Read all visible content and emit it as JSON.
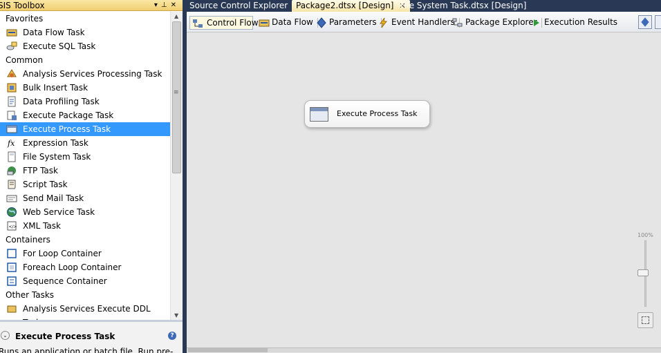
{
  "toolbox": {
    "title": "SIS Toolbox",
    "title_buttons": [
      "▾",
      "⊥",
      "✕"
    ],
    "groups": [
      {
        "label": "Favorites",
        "items": [
          {
            "label": "Data Flow Task",
            "icon": "data-flow-task-icon"
          },
          {
            "label": "Execute SQL Task",
            "icon": "execute-sql-task-icon"
          }
        ]
      },
      {
        "label": "Common",
        "items": [
          {
            "label": "Analysis Services Processing Task",
            "icon": "analysis-services-icon"
          },
          {
            "label": "Bulk Insert Task",
            "icon": "bulk-insert-icon"
          },
          {
            "label": "Data Profiling Task",
            "icon": "data-profiling-icon"
          },
          {
            "label": "Execute Package Task",
            "icon": "execute-package-icon"
          },
          {
            "label": "Execute Process Task",
            "icon": "execute-process-icon",
            "selected": true
          },
          {
            "label": "Expression Task",
            "icon": "expression-icon"
          },
          {
            "label": "File System Task",
            "icon": "file-system-icon"
          },
          {
            "label": "FTP Task",
            "icon": "ftp-icon"
          },
          {
            "label": "Script Task",
            "icon": "script-icon"
          },
          {
            "label": "Send Mail Task",
            "icon": "send-mail-icon"
          },
          {
            "label": "Web Service Task",
            "icon": "web-service-icon"
          },
          {
            "label": "XML Task",
            "icon": "xml-icon"
          }
        ]
      },
      {
        "label": "Containers",
        "items": [
          {
            "label": "For Loop Container",
            "icon": "for-loop-icon"
          },
          {
            "label": "Foreach Loop Container",
            "icon": "foreach-loop-icon"
          },
          {
            "label": "Sequence Container",
            "icon": "sequence-icon"
          }
        ]
      },
      {
        "label": "Other Tasks",
        "items": [
          {
            "label": "Analysis Services Execute DDL Task",
            "icon": "analysis-ddl-icon"
          }
        ]
      }
    ],
    "description": {
      "name": "Execute Process Task",
      "text": "Runs an application or batch file. Run pre-"
    }
  },
  "document_tabs": [
    {
      "label": "Source Control Explorer",
      "active": false
    },
    {
      "label": "Package2.dtsx [Design]",
      "active": true
    },
    {
      "label": "File System Task.dtsx [Design]",
      "active": false
    }
  ],
  "designer_tabs": [
    {
      "label": "Control Flow",
      "icon": "control-flow-icon",
      "active": true
    },
    {
      "label": "Data Flow",
      "icon": "data-flow-icon"
    },
    {
      "label": "Parameters",
      "icon": "parameters-icon"
    },
    {
      "label": "Event Handlers",
      "icon": "event-handlers-icon"
    },
    {
      "label": "Package Explorer",
      "icon": "package-explorer-icon"
    },
    {
      "label": "Execution Results",
      "icon": "execution-results-icon"
    }
  ],
  "canvas": {
    "task_label": "Execute Process Task",
    "zoom_label": "100%"
  },
  "colors": {
    "selection": "#3399ff",
    "frame": "#293955",
    "active_tab": "#f6e5a8"
  }
}
